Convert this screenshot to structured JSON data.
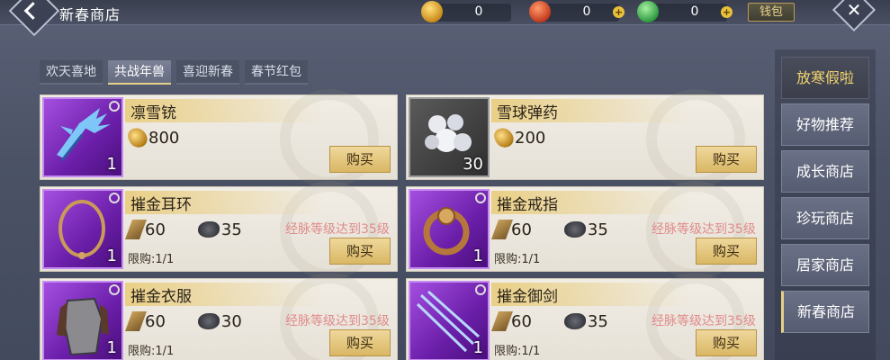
{
  "header": {
    "title": "新春商店",
    "currencies": [
      {
        "value": "0"
      },
      {
        "value": "0"
      },
      {
        "value": "0"
      }
    ],
    "wallet_label": "钱包"
  },
  "tabs": [
    {
      "label": "欢天喜地"
    },
    {
      "label": "共战年兽"
    },
    {
      "label": "喜迎新春"
    },
    {
      "label": "春节红包"
    }
  ],
  "items": [
    {
      "name": "凛雪铳",
      "qty": "1",
      "costs": [
        "800"
      ],
      "requirement": "",
      "limit": "",
      "buy": "购买"
    },
    {
      "name": "雪球弹药",
      "qty": "30",
      "costs": [
        "200"
      ],
      "requirement": "",
      "limit": "",
      "buy": "购买"
    },
    {
      "name": "摧金耳环",
      "qty": "1",
      "costs": [
        "60",
        "35"
      ],
      "requirement": "经脉等级达到35级",
      "limit": "限购:1/1",
      "buy": "购买"
    },
    {
      "name": "摧金戒指",
      "qty": "1",
      "costs": [
        "60",
        "35"
      ],
      "requirement": "经脉等级达到35级",
      "limit": "限购:1/1",
      "buy": "购买"
    },
    {
      "name": "摧金衣服",
      "qty": "1",
      "costs": [
        "60",
        "30"
      ],
      "requirement": "经脉等级达到35级",
      "limit": "限购:1/1",
      "buy": "购买"
    },
    {
      "name": "摧金御剑",
      "qty": "1",
      "costs": [
        "60",
        "35"
      ],
      "requirement": "经脉等级达到35级",
      "limit": "限购:1/1",
      "buy": "购买"
    }
  ],
  "side_nav": [
    {
      "label": "放寒假啦"
    },
    {
      "label": "好物推荐"
    },
    {
      "label": "成长商店"
    },
    {
      "label": "珍玩商店"
    },
    {
      "label": "居家商店"
    },
    {
      "label": "新春商店"
    }
  ]
}
